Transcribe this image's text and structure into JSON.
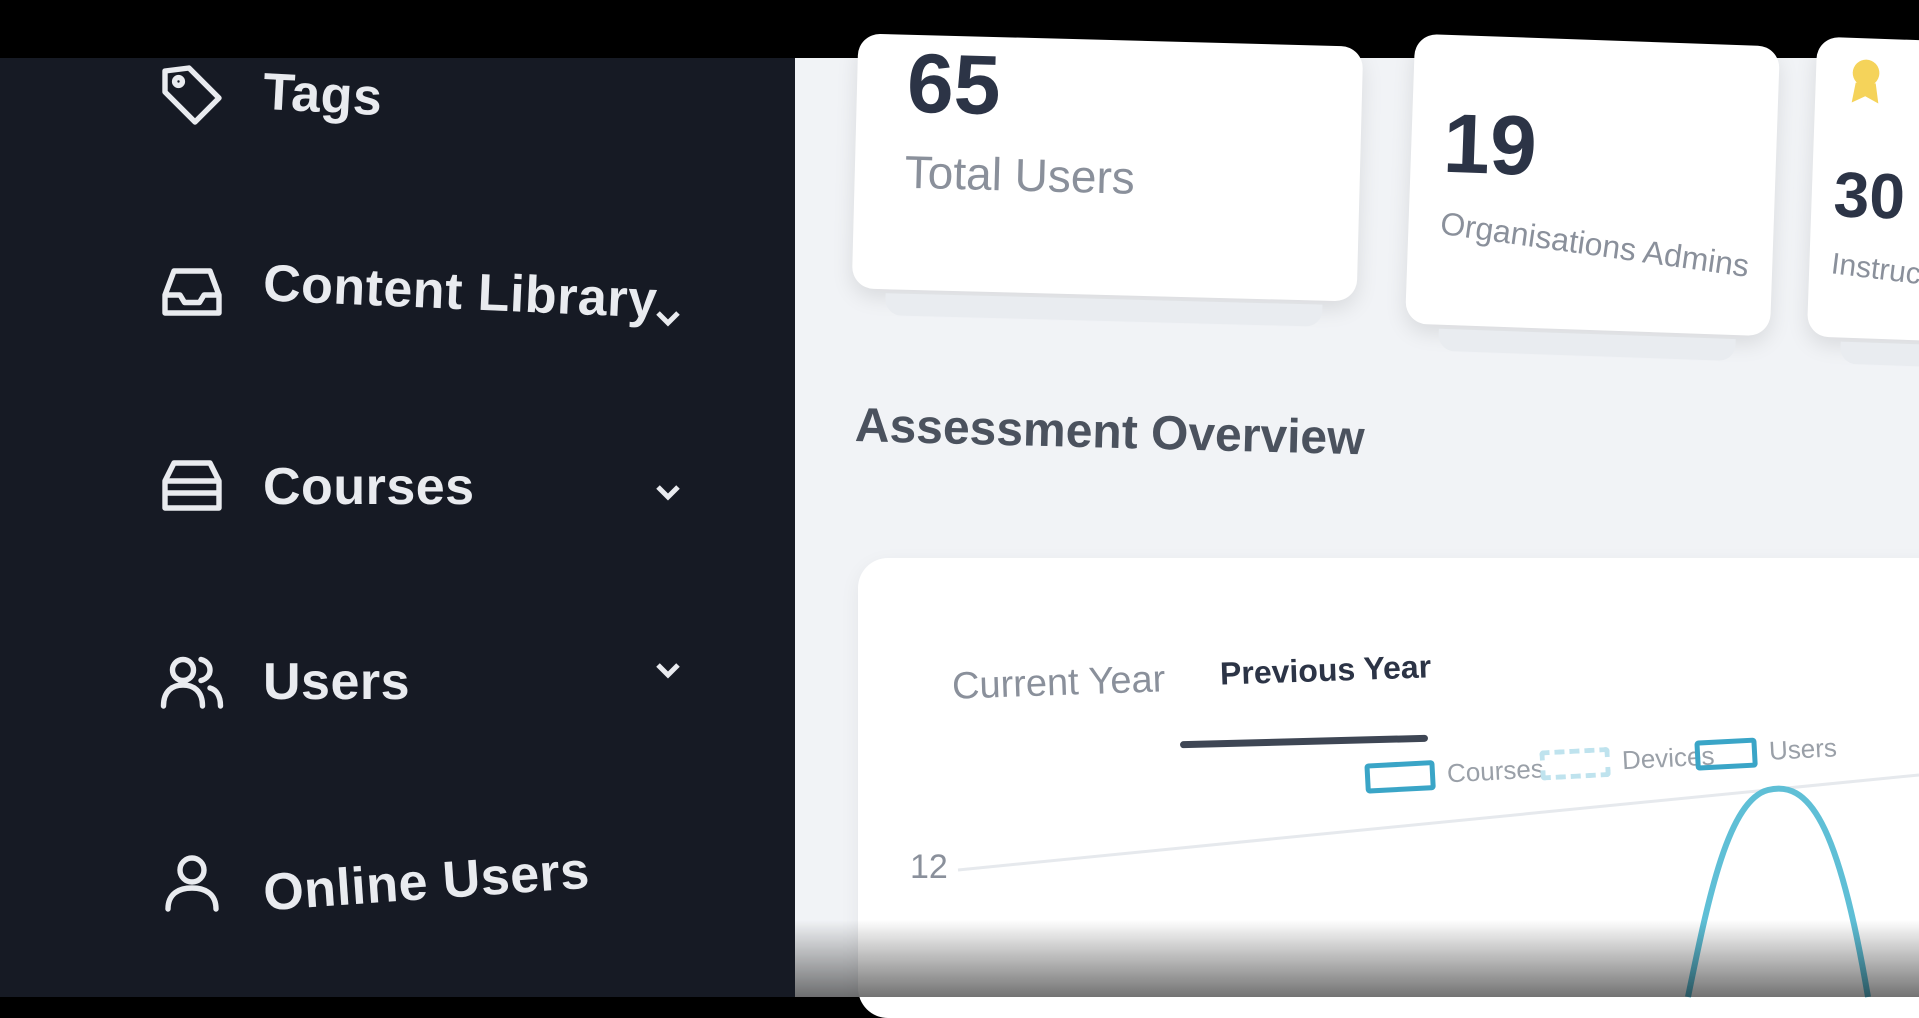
{
  "sidebar": {
    "items": [
      {
        "label": "Tags",
        "icon": "tag-icon",
        "has_chevron": false
      },
      {
        "label": "Content Library",
        "icon": "inbox-icon",
        "has_chevron": true
      },
      {
        "label": "Courses",
        "icon": "archive-icon",
        "has_chevron": true
      },
      {
        "label": "Users",
        "icon": "users-icon",
        "has_chevron": true
      },
      {
        "label": "Online Users",
        "icon": "user-icon",
        "has_chevron": false
      }
    ]
  },
  "stats": [
    {
      "value": "65",
      "label": "Total Users"
    },
    {
      "value": "19",
      "label": "Organisations Admins"
    },
    {
      "value": "30",
      "label": "Instructors",
      "visible_label": "Instructo"
    }
  ],
  "assessment": {
    "title": "Assessment Overview",
    "tabs": [
      {
        "label": "Current Year",
        "active": false
      },
      {
        "label": "Previous Year",
        "active": true
      }
    ]
  },
  "chart_data": {
    "type": "line",
    "series": [
      {
        "name": "Courses",
        "color": "#3aa5c7"
      },
      {
        "name": "Devices",
        "color": "#bfe3ee"
      },
      {
        "name": "Users",
        "color": "#3aa5c7"
      }
    ],
    "y_tick_labels": [
      "12"
    ]
  },
  "colors": {
    "sidebar_bg": "#161a24",
    "main_bg": "#f1f3f6",
    "accent": "#3aa5c7"
  }
}
